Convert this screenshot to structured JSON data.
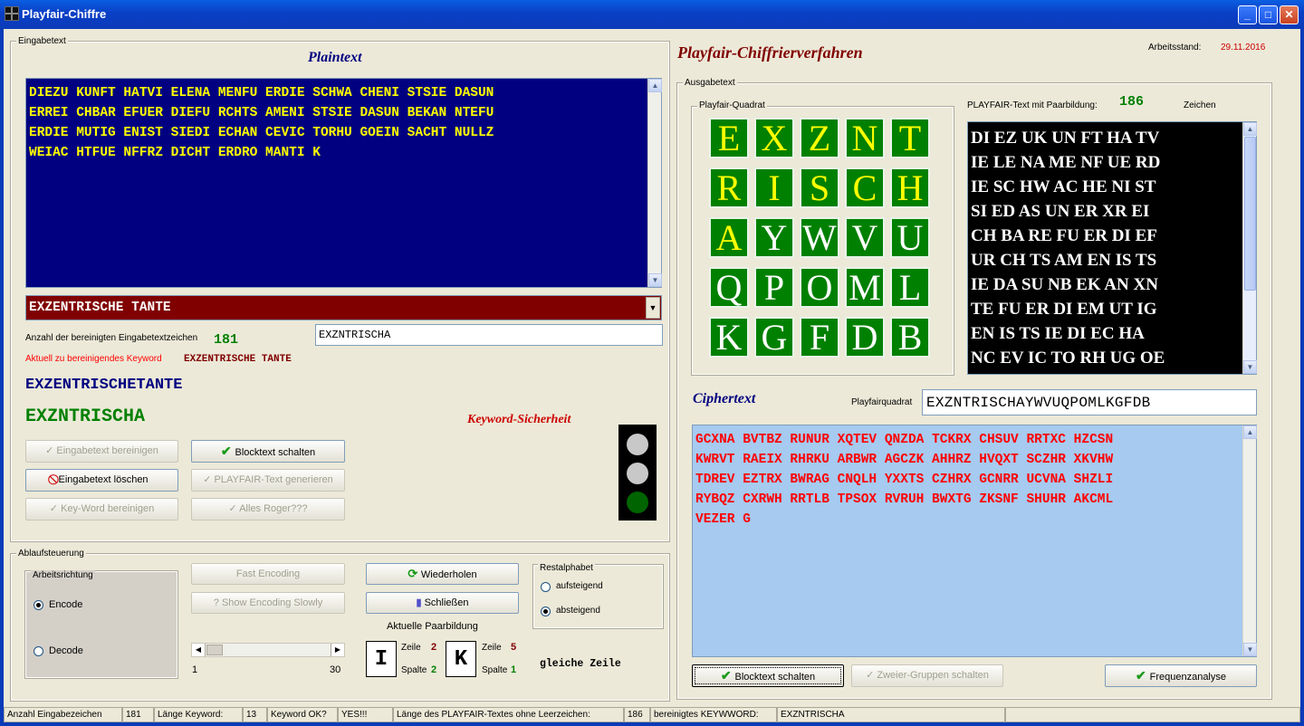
{
  "window": {
    "title": "Playfair-Chiffre",
    "min": "_",
    "max": "□",
    "close": "✕"
  },
  "left": {
    "group_label": "Eingabetext",
    "plaintext_title": "Plaintext",
    "plaintext_lines": [
      "DIEZU KUNFT HATVI ELENA MENFU ERDIE SCHWA CHENI STSIE DASUN",
      "ERREI CHBAR EFUER DIEFU RCHTS AMENI STSIE DASUN BEKAN NTEFU",
      "ERDIE MUTIG ENIST SIEDI ECHAN CEVIC TORHU GOEIN SACHT NULLZ",
      "WEIAC HTFUE NFFRZ DICHT ERDRO MANTI K"
    ],
    "keyword_combo": "EXZENTRISCHE TANTE",
    "count_label": "Anzahl der bereinigten Eingabetextzeichen",
    "count_value": "181",
    "cleaned_input": "EXZNTRISCHA",
    "current_label": "Aktuell zu bereinigendes Keyword",
    "current_value": "EXZENTRISCHE TANTE",
    "keyword_joined": "EXZENTRISCHETANTE",
    "keyword_cleaned": "EXZNTRISCHA",
    "security_label": "Keyword-Sicherheit",
    "buttons": {
      "clean_input": "Eingabetext bereinigen",
      "block_text": "Blocktext schalten",
      "delete_input": "Eingabetext löschen",
      "generate": "PLAYFAIR-Text generieren",
      "clean_keyword": "Key-Word bereinigen",
      "roger": "Alles Roger???"
    }
  },
  "control": {
    "group_label": "Ablaufsteuerung",
    "direction_label": "Arbeitsrichtung",
    "encode": "Encode",
    "decode": "Decode",
    "fast_encoding": "Fast Encoding",
    "slow_encoding": "Show Encoding Slowly",
    "repeat": "Wiederholen",
    "close": "Schließen",
    "rest_label": "Restalphabet",
    "ascending": "aufsteigend",
    "descending": "absteigend",
    "slider_min": "1",
    "slider_max": "30",
    "pair_label": "Aktuelle Paarbildung",
    "pair_a": {
      "letter": "I",
      "zeile_label": "Zeile",
      "zeile": "2",
      "spalte_label": "Spalte",
      "spalte": "2"
    },
    "pair_b": {
      "letter": "K",
      "zeile_label": "Zeile",
      "zeile": "5",
      "spalte_label": "Spalte",
      "spalte": "1"
    },
    "rule": "gleiche Zeile"
  },
  "right": {
    "title": "Playfair-Chiffrierverfahren",
    "date_label": "Arbeitsstand:",
    "date": "29.11.2016",
    "group_label": "Ausgabetext",
    "square_label": "Playfair-Quadrat",
    "square": [
      [
        "E",
        "X",
        "Z",
        "N",
        "T"
      ],
      [
        "R",
        "I",
        "S",
        "C",
        "H"
      ],
      [
        "A",
        "Y",
        "W",
        "V",
        "U"
      ],
      [
        "Q",
        "P",
        "O",
        "M",
        "L"
      ],
      [
        "K",
        "G",
        "F",
        "D",
        "B"
      ]
    ],
    "pair_text_label": "PLAYFAIR-Text mit Paarbildung:",
    "pair_count": "186",
    "chars_label": "Zeichen",
    "pair_lines": [
      "DI EZ UK UN FT HA TV",
      "IE LE NA ME NF UE RD",
      "IE SC HW AC HE NI ST",
      "SI ED AS UN ER XR EI",
      "CH BA RE FU ER DI EF",
      "UR CH TS AM EN IS TS",
      "IE DA SU NB EK AN XN",
      "TE FU ER DI EM UT IG",
      "EN IS TS IE DI EC HA",
      "NC EV IC TO RH UG OE"
    ],
    "cipher_title": "Ciphertext",
    "square_field_label": "Playfairquadrat",
    "square_field": "EXZNTRISCHAYWVUQPOMLKGFDB",
    "cipher_lines": [
      "GCXNA BVTBZ RUNUR XQTEV QNZDA TCKRX CHSUV RRTXC HZCSN",
      "KWRVT RAEIX RHRKU ARBWR AGCZK AHHRZ HVQXT SCZHR XKVHW",
      "TDREV EZTRX BWRAG CNQLH YXXTS CZHRX GCNRR UCVNA SHZLI",
      "RYBQZ CXRWH RRTLB TPSOX RVRUH BWXTG ZKSNF SHUHR AKCML",
      "VEZER G"
    ],
    "buttons": {
      "block": "Blocktext schalten",
      "groups": "Zweier-Gruppen schalten",
      "freq": "Frequenzanalyse"
    }
  },
  "status": [
    "Anzahl Eingabezeichen",
    "181",
    "Länge Keyword:",
    "13",
    "Keyword OK?",
    "YES!!!",
    "Länge des PLAYFAIR-Textes ohne Leerzeichen:",
    "186",
    "bereinigtes KEYWWORD:",
    "EXZNTRISCHA",
    ""
  ],
  "colors": {
    "plain_bg": "#000080",
    "plain_fg": "#ffff00",
    "combo_bg": "#800000",
    "square_bg": "#008000",
    "cipher_bg": "#a6caf0",
    "cipher_fg": "#ff0000",
    "pairs_bg": "#000000",
    "titlebar": "#0a3fc6"
  },
  "icons": [
    "check-icon",
    "no-entry-icon",
    "refresh-icon",
    "exit-icon",
    "help-icon",
    "traffic-light-icon"
  ]
}
